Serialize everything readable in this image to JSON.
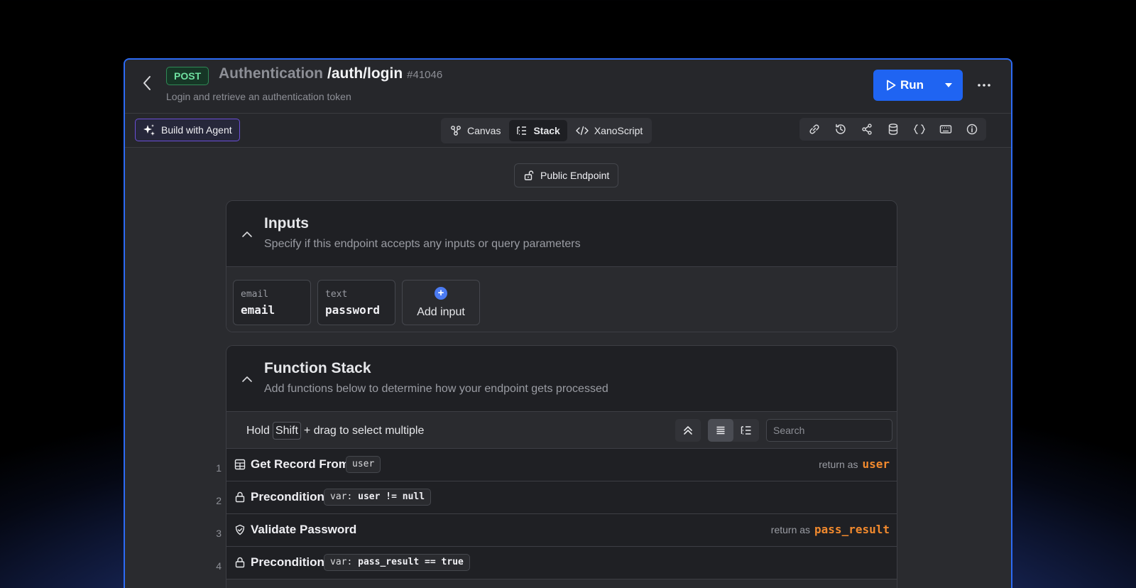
{
  "header": {
    "method": "POST",
    "group": "Authentication",
    "path": "/auth/login",
    "id": "#41046",
    "subtitle": "Login and retrieve an authentication token",
    "run_label": "Run"
  },
  "toolbar": {
    "agent_label": "Build with Agent",
    "tabs": [
      {
        "label": "Canvas",
        "icon": "canvas-icon"
      },
      {
        "label": "Stack",
        "icon": "stack-icon",
        "active": true
      },
      {
        "label": "XanoScript",
        "icon": "code-icon"
      }
    ],
    "icons": [
      "link-icon",
      "history-icon",
      "share-icon",
      "database-icon",
      "braces-icon",
      "keyboard-icon",
      "info-icon"
    ]
  },
  "access": {
    "label": "Public Endpoint"
  },
  "inputs": {
    "title": "Inputs",
    "description": "Specify if this endpoint accepts any inputs or query parameters",
    "items": [
      {
        "type": "email",
        "name": "email"
      },
      {
        "type": "text",
        "name": "password"
      }
    ],
    "add_label": "Add input"
  },
  "function_stack": {
    "title": "Function Stack",
    "description": "Add functions below to determine how your endpoint gets processed",
    "hint_prefix": "Hold",
    "hint_key": "Shift",
    "hint_suffix": "+ drag to select multiple",
    "search_placeholder": "Search",
    "return_label": "return as",
    "rows": [
      {
        "num": "1",
        "icon": "table-icon",
        "title": "Get Record From",
        "tag": "user",
        "return_var": "user"
      },
      {
        "num": "2",
        "icon": "lock-icon",
        "title": "Precondition",
        "tag_prefix": "var:",
        "tag": "user != null",
        "return_var": ""
      },
      {
        "num": "3",
        "icon": "shield-check-icon",
        "title": "Validate Password",
        "tag": "",
        "return_var": "pass_result"
      },
      {
        "num": "4",
        "icon": "lock-icon",
        "title": "Precondition",
        "tag_prefix": "var:",
        "tag": "pass_result == true",
        "return_var": ""
      }
    ]
  },
  "colors": {
    "accent": "#1f64f2",
    "post_green": "#6fe0a0",
    "return_orange": "#f28a2e",
    "agent_purple": "#6a4fd8"
  }
}
